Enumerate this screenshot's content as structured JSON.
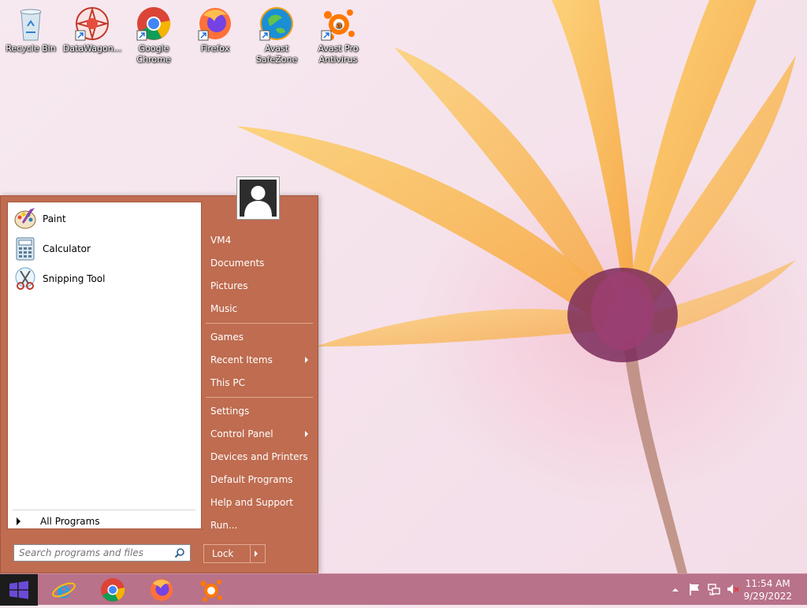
{
  "desktop": {
    "icons": [
      {
        "name": "recycle-bin-icon",
        "label": "Recycle Bin"
      },
      {
        "name": "datawagon-icon",
        "label": "DataWagon..."
      },
      {
        "name": "google-chrome-icon",
        "label": "Google Chrome"
      },
      {
        "name": "firefox-icon",
        "label": "Firefox"
      },
      {
        "name": "avast-safezone-icon",
        "label": "Avast SafeZone"
      },
      {
        "name": "avast-pro-antivirus-icon",
        "label": "Avast Pro Antivirus"
      }
    ]
  },
  "start_menu": {
    "pinned": [
      {
        "label": "Paint",
        "icon": "paint-icon"
      },
      {
        "label": "Calculator",
        "icon": "calculator-icon"
      },
      {
        "label": "Snipping Tool",
        "icon": "snipping-tool-icon"
      }
    ],
    "all_programs": "All Programs",
    "search_placeholder": "Search programs and files",
    "right_items": [
      "VM4",
      "Documents",
      "Pictures",
      "Music",
      "Games",
      "Recent Items",
      "This PC",
      "Settings",
      "Control Panel",
      "Devices and Printers",
      "Default Programs",
      "Help and Support",
      "Run..."
    ],
    "lock_label": "Lock",
    "colors": {
      "panel": "#bf6c50",
      "border": "#a4583f"
    }
  },
  "taskbar": {
    "pinned_apps": [
      "internet-explorer-icon",
      "google-chrome-icon",
      "firefox-icon",
      "avast-icon"
    ],
    "tray_icons": [
      "show-hidden-icons-arrow",
      "action-center-flag-icon",
      "network-icon",
      "volume-muted-icon"
    ],
    "time": "11:54 AM",
    "date": "9/29/2022",
    "color": "#b8728a"
  }
}
